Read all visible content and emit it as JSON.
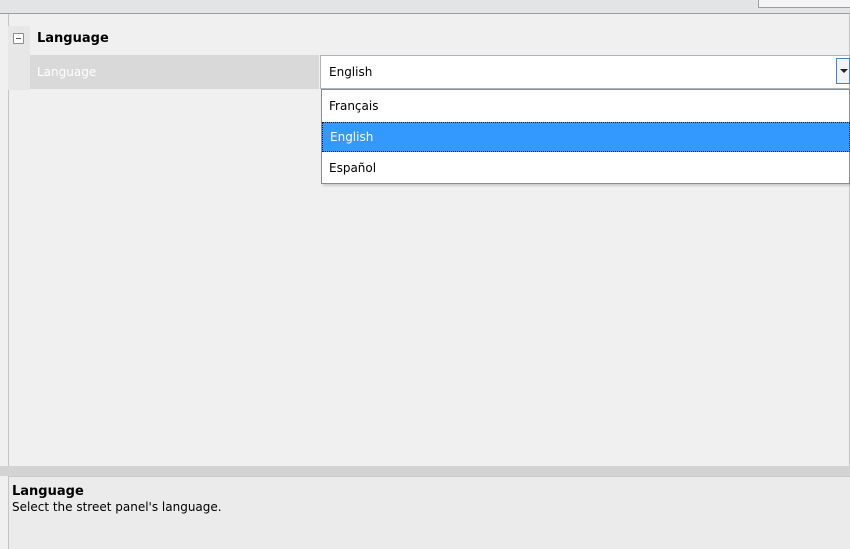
{
  "category": {
    "label": "Language",
    "icon": "collapse-minus-icon"
  },
  "property": {
    "name": "Language",
    "value": "English"
  },
  "dropdown": {
    "options": [
      "Français",
      "English",
      "Español"
    ],
    "selected": "English"
  },
  "help": {
    "title": "Language",
    "description": "Select the street panel's language."
  },
  "colors": {
    "selection": "#3399ff",
    "name_cell_bg": "#d9d9d9",
    "grid_bg": "#f0f0f0"
  }
}
